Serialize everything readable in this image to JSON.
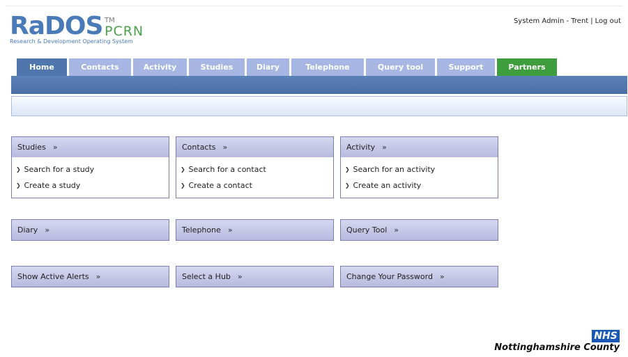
{
  "logo": {
    "word": "RaDOS",
    "tm": "TM",
    "pcrn": "PCRN",
    "subtitle": "Research & Development Operating System"
  },
  "user_bar": {
    "user": "System Admin - Trent",
    "separator": "|",
    "logout": "Log out"
  },
  "tabs": [
    {
      "label": "Home",
      "active": true
    },
    {
      "label": "Contacts"
    },
    {
      "label": "Activity"
    },
    {
      "label": "Studies"
    },
    {
      "label": "Diary"
    },
    {
      "label": "Telephone"
    },
    {
      "label": "Query tool"
    },
    {
      "label": "Support"
    },
    {
      "label": "Partners"
    }
  ],
  "panels": {
    "studies": {
      "title": "Studies",
      "links": [
        "Search for a study",
        "Create a study"
      ]
    },
    "contacts": {
      "title": "Contacts",
      "links": [
        "Search for a contact",
        "Create a contact"
      ]
    },
    "activity": {
      "title": "Activity",
      "links": [
        "Search for an activity",
        "Create an activity"
      ]
    },
    "diary": {
      "title": "Diary"
    },
    "telephone": {
      "title": "Telephone"
    },
    "query_tool": {
      "title": "Query Tool"
    },
    "alerts": {
      "title": "Show Active Alerts"
    },
    "hub": {
      "title": "Select a Hub"
    },
    "password": {
      "title": "Change Your Password"
    }
  },
  "chevron": "»",
  "bullet": "❯",
  "footer": {
    "nhs": "NHS",
    "org": "Nottinghamshire County"
  },
  "colors": {
    "tab_inactive": "#a7b6e3",
    "tab_active": "#4f77ad",
    "tab_partners": "#3e9e3e",
    "band": "#4f77ad",
    "panel_border": "#7b7fae",
    "logo_blue": "#4a7ab8",
    "logo_green": "#4aa34a",
    "nhs_blue": "#1a58b5"
  }
}
